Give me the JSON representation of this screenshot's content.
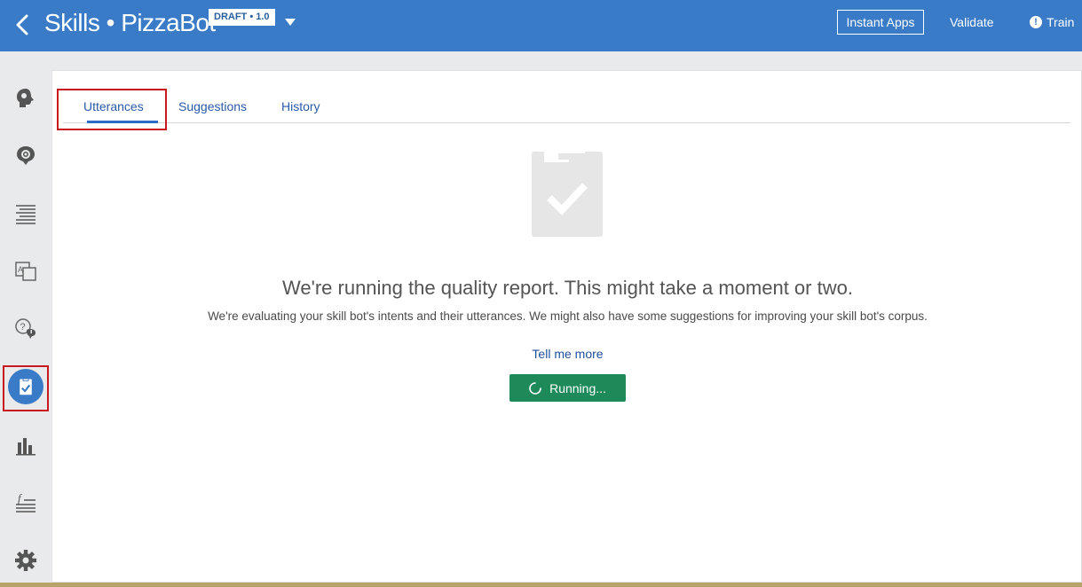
{
  "header": {
    "title": "Skills • PizzaBot",
    "badge": "DRAFT • 1.0",
    "instant_apps_label": "Instant Apps",
    "validate_label": "Validate",
    "train_label": "Train",
    "background_color": "#3a7bc8"
  },
  "sidebar": {
    "items": [
      {
        "icon": "intents-icon"
      },
      {
        "icon": "entities-icon"
      },
      {
        "icon": "flows-icon"
      },
      {
        "icon": "resource-bundles-icon"
      },
      {
        "icon": "qna-icon"
      },
      {
        "icon": "quality-icon",
        "active": true
      },
      {
        "icon": "insights-icon"
      },
      {
        "icon": "components-icon"
      },
      {
        "icon": "settings-icon"
      }
    ]
  },
  "tabs": [
    {
      "label": "Utterances",
      "active": true
    },
    {
      "label": "Suggestions"
    },
    {
      "label": "History"
    }
  ],
  "main": {
    "headline": "We're running the quality report. This might take a moment or two.",
    "subtext": "We're evaluating your skill bot's intents and their utterances. We might also have some suggestions for improving your skill bot's corpus.",
    "link_label": "Tell me more",
    "running_label": "Running...",
    "running_button_color": "#1e8a5a"
  }
}
